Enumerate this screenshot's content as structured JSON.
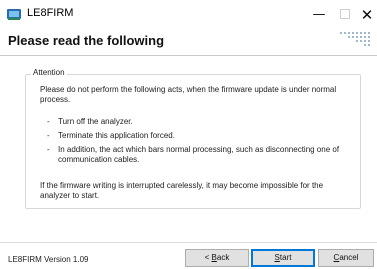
{
  "window": {
    "title": "LE8FIRM",
    "controls": [
      "minimize",
      "maximize",
      "close"
    ]
  },
  "header": {
    "title": "Please read the following"
  },
  "attention": {
    "label": "Attention",
    "intro": "Please do not perform the following acts, when the firmware update is under normal process.",
    "bullets": [
      {
        "dash": "-",
        "text": "Turn off the analyzer."
      },
      {
        "dash": "-",
        "text": "Terminate this application forced."
      },
      {
        "dash": "-",
        "text": "In addition, the act which bars normal processing, such as disconnecting one of communication cables."
      }
    ],
    "warning": "If the firmware writing is interrupted carelessly, it may become impossible for the analyzer to start."
  },
  "footer": {
    "version": "LE8FIRM Version 1.09",
    "buttons": {
      "back": {
        "prefix": "< ",
        "accel": "B",
        "rest": "ack"
      },
      "start": {
        "accel": "S",
        "rest": "tart"
      },
      "cancel": {
        "accel": "C",
        "rest": "ancel"
      }
    }
  },
  "colors": {
    "accent_border": "#0078d7",
    "button_face": "#e1e1e1",
    "logo_dots": "#9fb8cc"
  },
  "icons": [
    "app-icon",
    "dots-logo-icon",
    "minimize-icon",
    "maximize-icon",
    "close-icon"
  ]
}
